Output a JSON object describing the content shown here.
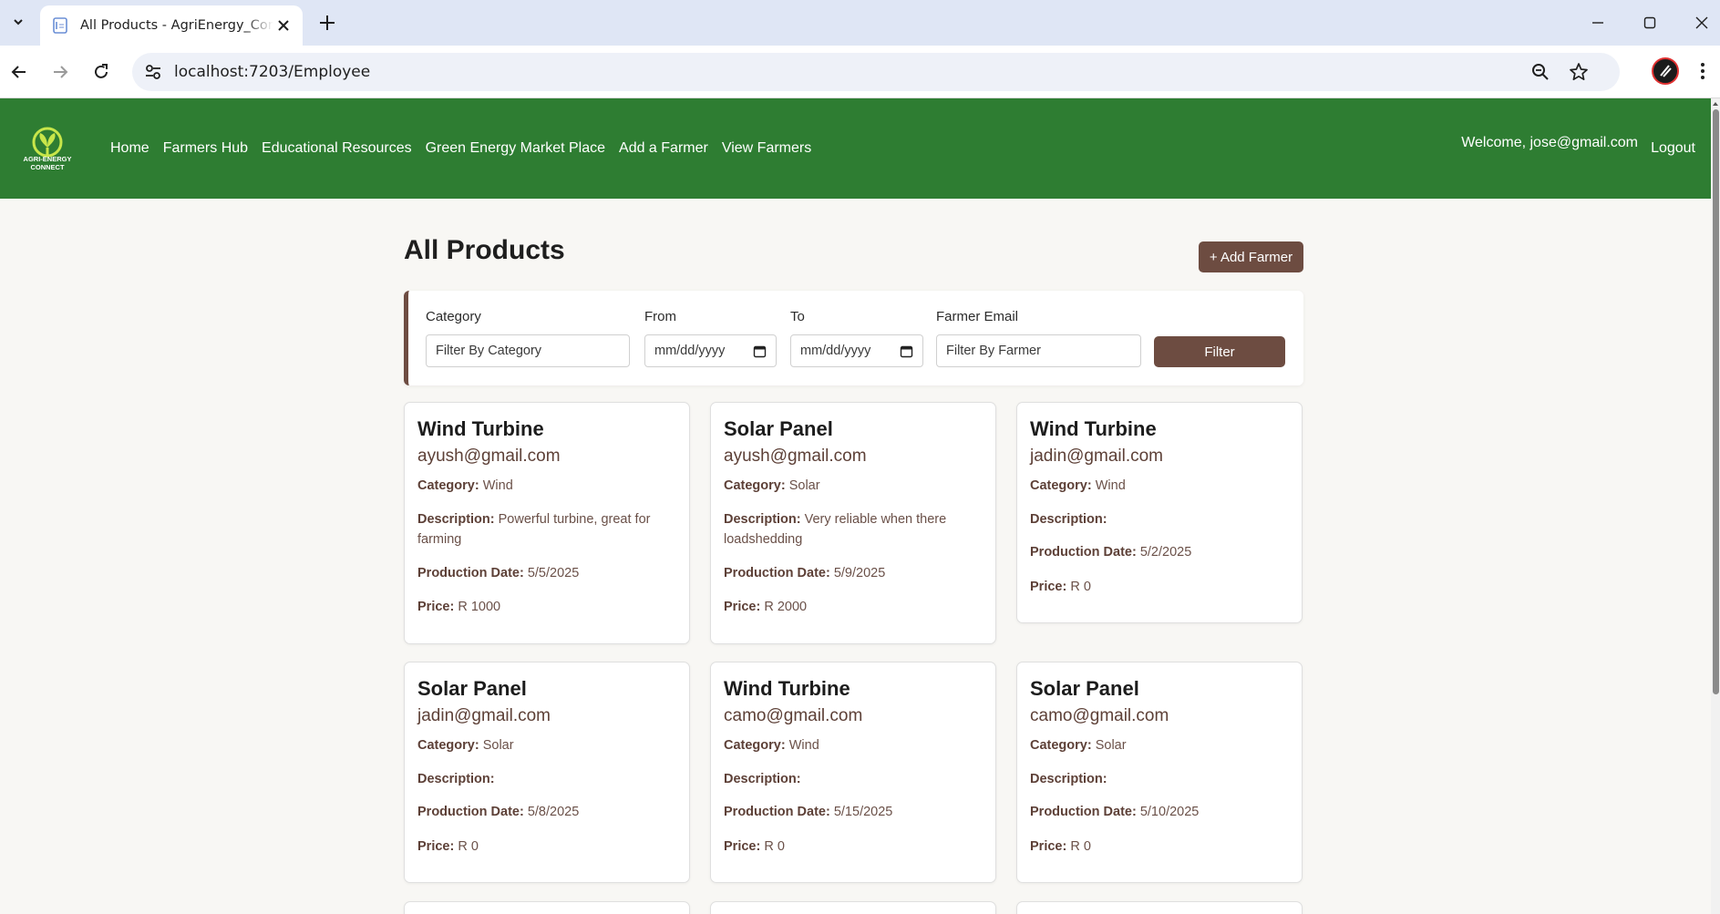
{
  "browser": {
    "tab_title": "All Products - AgriEnergy_Connect",
    "url": "localhost:7203/Employee"
  },
  "navbar": {
    "logo_text": "AGRI-ENERGY CONNECT",
    "links": [
      "Home",
      "Farmers Hub",
      "Educational Resources",
      "Green Energy Market Place",
      "Add a Farmer",
      "View Farmers"
    ],
    "welcome": "Welcome, jose@gmail.com",
    "logout": "Logout"
  },
  "page": {
    "title": "All Products",
    "add_button": "+ Add Farmer"
  },
  "filters": {
    "category_label": "Category",
    "category_placeholder": "Filter By Category",
    "from_label": "From",
    "from_value": "mm/dd/yyyy",
    "to_label": "To",
    "to_value": "mm/dd/yyyy",
    "email_label": "Farmer Email",
    "email_placeholder": "Filter By Farmer",
    "filter_button": "Filter"
  },
  "labels": {
    "category": "Category:",
    "description": "Description:",
    "production_date": "Production Date:",
    "price": "Price:"
  },
  "products": [
    {
      "name": "Wind Turbine",
      "email": "ayush@gmail.com",
      "category": "Wind",
      "description": "Powerful turbine, great for farming",
      "date": "5/5/2025",
      "price": "R 1000"
    },
    {
      "name": "Solar Panel",
      "email": "ayush@gmail.com",
      "category": "Solar",
      "description": "Very reliable when there loadshedding",
      "date": "5/9/2025",
      "price": "R 2000"
    },
    {
      "name": "Wind Turbine",
      "email": "jadin@gmail.com",
      "category": "Wind",
      "description": "",
      "date": "5/2/2025",
      "price": "R 0"
    },
    {
      "name": "Solar Panel",
      "email": "jadin@gmail.com",
      "category": "Solar",
      "description": "",
      "date": "5/8/2025",
      "price": "R 0"
    },
    {
      "name": "Wind Turbine",
      "email": "camo@gmail.com",
      "category": "Wind",
      "description": "",
      "date": "5/15/2025",
      "price": "R 0"
    },
    {
      "name": "Solar Panel",
      "email": "camo@gmail.com",
      "category": "Solar",
      "description": "",
      "date": "5/10/2025",
      "price": "R 0"
    }
  ]
}
